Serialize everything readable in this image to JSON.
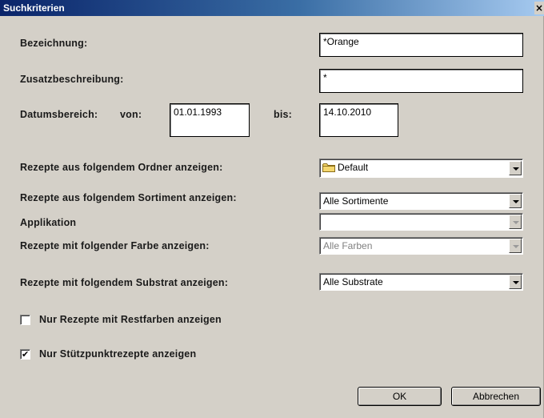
{
  "window": {
    "title": "Suchkriterien",
    "close_label": "×"
  },
  "fields": {
    "bezeichnung_label": "Bezeichnung:",
    "bezeichnung_value": "*Orange",
    "zusatz_label": "Zusatzbeschreibung:",
    "zusatz_value": "*",
    "datum_label": "Datumsbereich:",
    "von_label": "von:",
    "von_value": "01.01.1993",
    "bis_label": "bis:",
    "bis_value": "14.10.2010"
  },
  "filters": {
    "ordner_label": "Rezepte aus folgendem Ordner anzeigen:",
    "ordner_value": "Default",
    "sortiment_label": "Rezepte aus folgendem Sortiment anzeigen:",
    "sortiment_value": "Alle Sortimente",
    "applikation_label": "Applikation",
    "applikation_value": "",
    "farbe_label": "Rezepte mit folgender Farbe anzeigen:",
    "farbe_value": "Alle Farben",
    "substrat_label": "Rezepte mit folgendem Substrat anzeigen:",
    "substrat_value": "Alle Substrate"
  },
  "options": {
    "restfarben_label": "Nur Rezepte mit Restfarben anzeigen",
    "restfarben_checked": false,
    "stuetzpunkt_label": "Nur Stützpunktrezepte anzeigen",
    "stuetzpunkt_checked": true,
    "check_glyph": "✔"
  },
  "buttons": {
    "ok_label": "OK",
    "cancel_label": "Abbrechen"
  },
  "colors": {
    "dialog_bg": "#d4d0c8",
    "titlebar_start": "#0a246a",
    "titlebar_end": "#a6caf0"
  }
}
